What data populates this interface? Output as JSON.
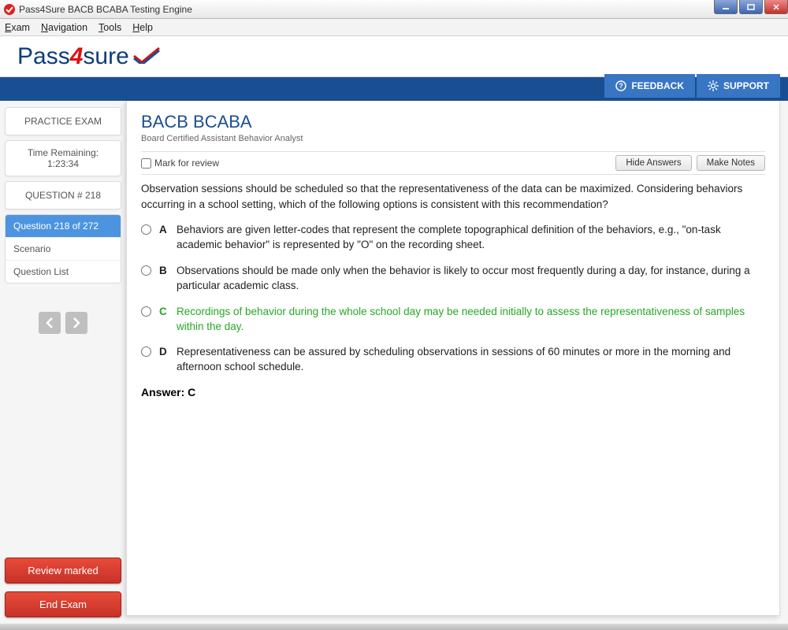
{
  "window": {
    "title": "Pass4Sure BACB BCABA Testing Engine"
  },
  "menu": {
    "exam": "Exam",
    "navigation": "Navigation",
    "tools": "Tools",
    "help": "Help"
  },
  "logo": {
    "pass": "Pass",
    "four": "4",
    "sure": "sure"
  },
  "ribbon": {
    "feedback": "FEEDBACK",
    "support": "SUPPORT"
  },
  "sidebar": {
    "practice": "PRACTICE EXAM",
    "time_label": "Time Remaining:",
    "time_value": "1:23:34",
    "question_label": "QUESTION # 218",
    "items": [
      {
        "label": "Question 218 of 272",
        "active": true
      },
      {
        "label": "Scenario",
        "active": false
      },
      {
        "label": "Question List",
        "active": false
      }
    ],
    "review_marked": "Review marked",
    "end_exam": "End Exam"
  },
  "exam": {
    "title": "BACB BCABA",
    "subtitle": "Board Certified Assistant Behavior Analyst",
    "mark_label": "Mark for review",
    "hide_answers": "Hide Answers",
    "make_notes": "Make Notes",
    "question_text": "Observation sessions should be scheduled so that the representativeness of the data can be maximized. Considering behaviors occurring in a school setting, which of the following options is consistent with this recommendation?",
    "options": [
      {
        "letter": "A",
        "text": "Behaviors are given letter-codes that represent the complete topographical definition of the behaviors, e.g., \"on-task academic behavior\" is represented by \"O\" on the recording sheet.",
        "correct": false
      },
      {
        "letter": "B",
        "text": "Observations should be made only when the behavior is likely to occur most frequently during a day, for instance, during a particular academic class.",
        "correct": false
      },
      {
        "letter": "C",
        "text": "Recordings of behavior during the whole school day may be needed initially to assess the representativeness of samples within the day.",
        "correct": true
      },
      {
        "letter": "D",
        "text": "Representativeness can be assured by scheduling observations in sessions of 60 minutes or more in the morning and afternoon school schedule.",
        "correct": false
      }
    ],
    "answer_label": "Answer: C"
  }
}
